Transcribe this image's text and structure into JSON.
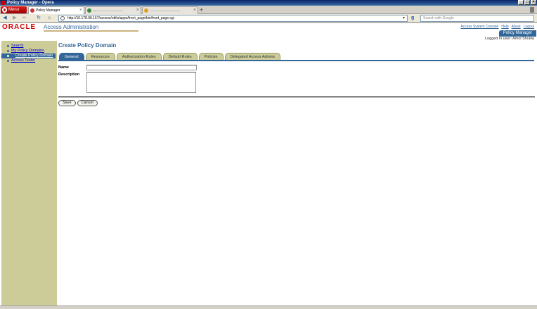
{
  "window": {
    "title": "Policy Manager - Opera"
  },
  "browser": {
    "menu_label": "Menu",
    "tabs": [
      {
        "label": "Policy Manager",
        "icon": "opera-favicon",
        "color": "#cc3333"
      },
      {
        "label": "...............................",
        "icon": "page-favicon",
        "color": "#3a8a3a"
      },
      {
        "label": "...............................",
        "icon": "page-favicon",
        "color": "#e0a020"
      }
    ],
    "address": "http://10.178.90.167/access/oblix/apps/front_page/bin/front_page.cgi",
    "search_placeholder": "Search with Google"
  },
  "header": {
    "logo": "ORACLE",
    "app_title": "Access Administration",
    "links": [
      "Access System Console",
      "Help",
      "About",
      "Logout"
    ],
    "role_badge": "Policy Manager",
    "logged_in": "Logged in user: Amol Shukla"
  },
  "sidebar": {
    "items": [
      {
        "label": "Search"
      },
      {
        "label": "My Policy Domains"
      },
      {
        "label": "Create Policy Domain"
      },
      {
        "label": "Access Tester"
      }
    ]
  },
  "main": {
    "title": "Create Policy Domain",
    "tabs": [
      {
        "label": "General"
      },
      {
        "label": "Resources"
      },
      {
        "label": "Authorization Rules"
      },
      {
        "label": "Default Rules"
      },
      {
        "label": "Policies"
      },
      {
        "label": "Delegated Access Admins"
      }
    ],
    "name_label": "Name",
    "description_label": "Description",
    "name_value": "",
    "description_value": "",
    "save_label": "Save",
    "cancel_label": "Cancel"
  },
  "colors": {
    "accent": "#336699",
    "sidebar": "#cccc99",
    "oracle_red": "#cc0000"
  }
}
